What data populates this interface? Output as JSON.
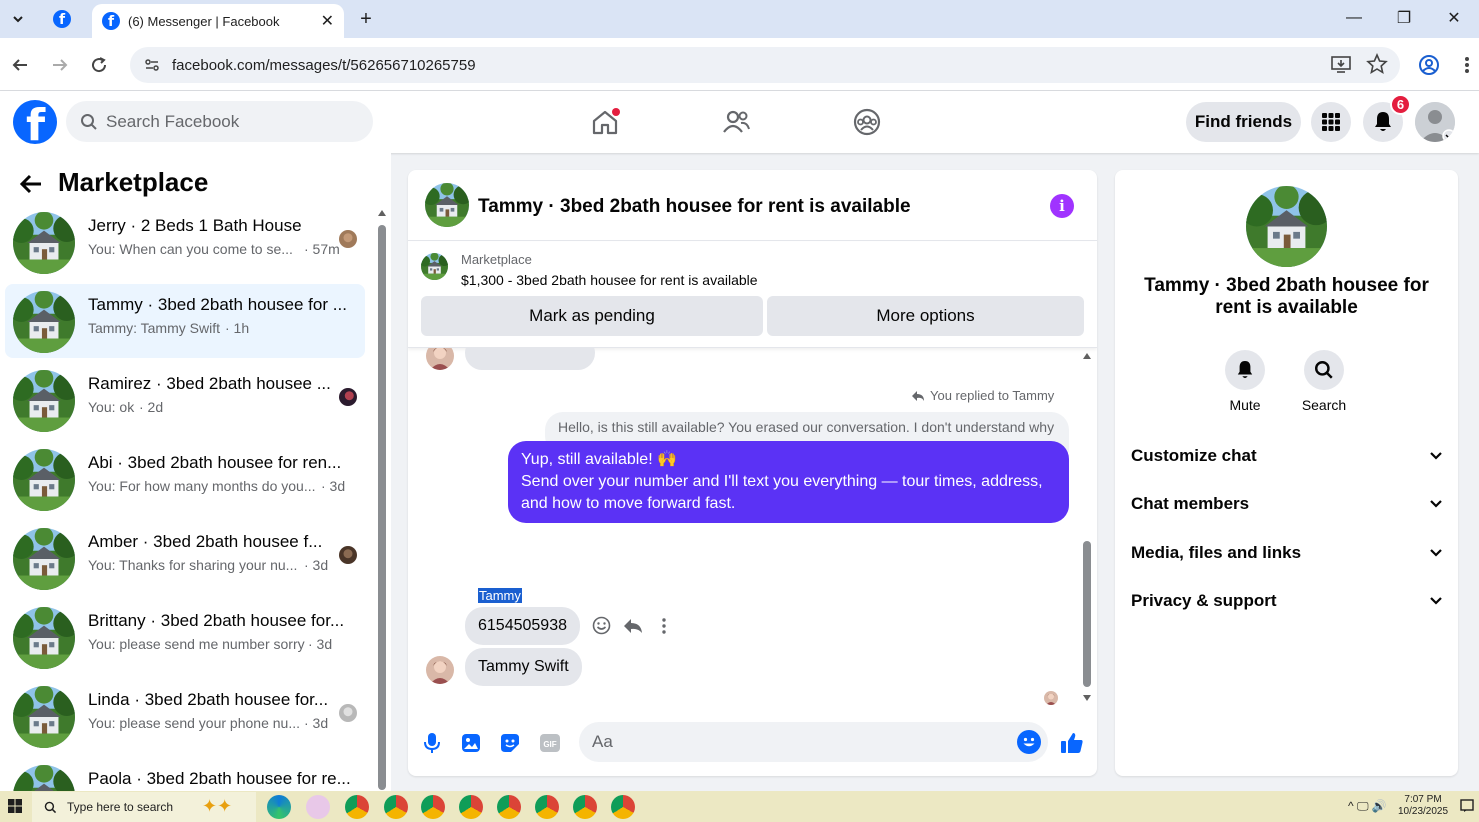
{
  "browser": {
    "tab_title": "(6) Messenger | Facebook",
    "url": "facebook.com/messages/t/562656710265759"
  },
  "fb": {
    "search_placeholder": "Search Facebook",
    "find_friends": "Find friends",
    "notification_count": "6",
    "brand_color": "#0866ff"
  },
  "sidebar": {
    "title": "Marketplace",
    "conversations": [
      {
        "name": "Jerry · 2 Beds 1 Bath House",
        "preview": "You: When can you come to se...",
        "time": "· 57m"
      },
      {
        "name": "Tammy · 3bed 2bath housee for ...",
        "preview": "Tammy: Tammy Swift",
        "time": "· 1h"
      },
      {
        "name": "Ramirez · 3bed 2bath housee ...",
        "preview": "You: ok",
        "time": "· 2d"
      },
      {
        "name": "Abi · 3bed 2bath housee for ren...",
        "preview": "You: For how many months do you...",
        "time": "· 3d"
      },
      {
        "name": "Amber · 3bed 2bath housee f...",
        "preview": "You: Thanks for sharing your nu...",
        "time": "· 3d"
      },
      {
        "name": "Brittany · 3bed 2bath housee for...",
        "preview": "You: please send me number sorry",
        "time": "· 3d"
      },
      {
        "name": "Linda · 3bed 2bath housee for...",
        "preview": "You: please send your phone nu...",
        "time": "· 3d"
      },
      {
        "name": "Paola · 3bed 2bath housee for re...",
        "preview": "",
        "time": ""
      }
    ]
  },
  "chat": {
    "title": "Tammy · 3bed 2bath housee for rent is available",
    "listing_category": "Marketplace",
    "listing_desc": "$1,300 - 3bed 2bath housee for rent is available",
    "btn_pending": "Mark as pending",
    "btn_more": "More options",
    "reply_note": "You replied to Tammy",
    "quoted_text": "Hello, is this still available? You erased our conversation. I don't understand why",
    "out_lines": [
      "Yup, still available! 🙌",
      "Send over your number and I'll text you everything — tour times, address,",
      "and how to move forward fast."
    ],
    "sender_label": "Tammy",
    "msg_phone": "6154505938",
    "msg_name": "Tammy Swift",
    "input_placeholder": "Aa",
    "accent_color": "#5b32f5"
  },
  "info": {
    "name": "Tammy · 3bed 2bath housee for rent is available",
    "mute": "Mute",
    "search": "Search",
    "rows": [
      "Customize chat",
      "Chat members",
      "Media, files and links",
      "Privacy & support"
    ]
  },
  "taskbar": {
    "search_placeholder": "Type here to search",
    "time": "7:07 PM",
    "date": "10/23/2025"
  }
}
